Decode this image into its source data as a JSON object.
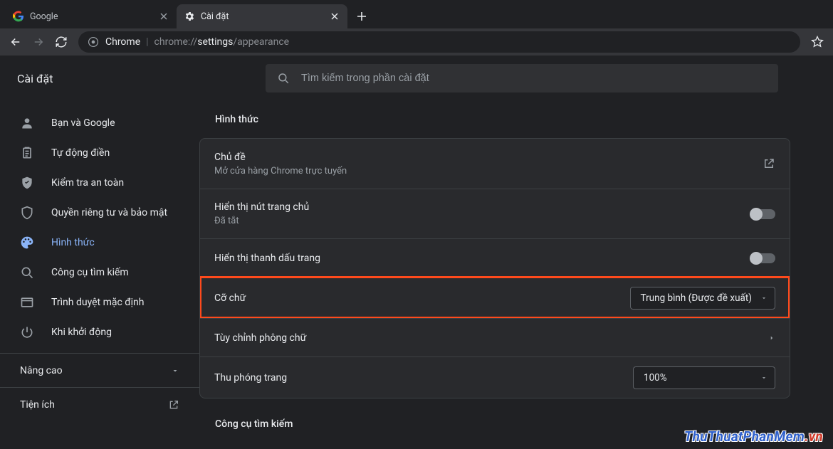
{
  "tabs": [
    {
      "title": "Google"
    },
    {
      "title": "Cài đặt"
    }
  ],
  "omnibox": {
    "scheme_label": "Chrome",
    "path_pre": "chrome://",
    "path_strong": "settings",
    "path_post": "/appearance"
  },
  "page": {
    "title": "Cài đặt"
  },
  "search": {
    "placeholder": "Tìm kiếm trong phần cài đặt"
  },
  "sidebar": {
    "items": [
      {
        "label": "Bạn và Google"
      },
      {
        "label": "Tự động điền"
      },
      {
        "label": "Kiểm tra an toàn"
      },
      {
        "label": "Quyền riêng tư và bảo mật"
      },
      {
        "label": "Hình thức"
      },
      {
        "label": "Công cụ tìm kiếm"
      },
      {
        "label": "Trình duyệt mặc định"
      },
      {
        "label": "Khi khởi động"
      }
    ],
    "advanced": "Nâng cao",
    "extensions": "Tiện ích"
  },
  "appearance": {
    "title": "Hình thức",
    "theme": {
      "label": "Chủ đề",
      "sub": "Mở cửa hàng Chrome trực tuyến"
    },
    "home_button": {
      "label": "Hiển thị nút trang chủ",
      "sub": "Đã tắt"
    },
    "bookmarks_bar": {
      "label": "Hiển thị thanh dấu trang"
    },
    "font_size": {
      "label": "Cỡ chữ",
      "value": "Trung bình (Được đề xuất)"
    },
    "customize_fonts": {
      "label": "Tùy chỉnh phông chữ"
    },
    "page_zoom": {
      "label": "Thu phóng trang",
      "value": "100%"
    }
  },
  "search_engine": {
    "title": "Công cụ tìm kiếm"
  },
  "watermark": {
    "a": "ThuThuatPhanMem",
    "b": ".vn"
  }
}
